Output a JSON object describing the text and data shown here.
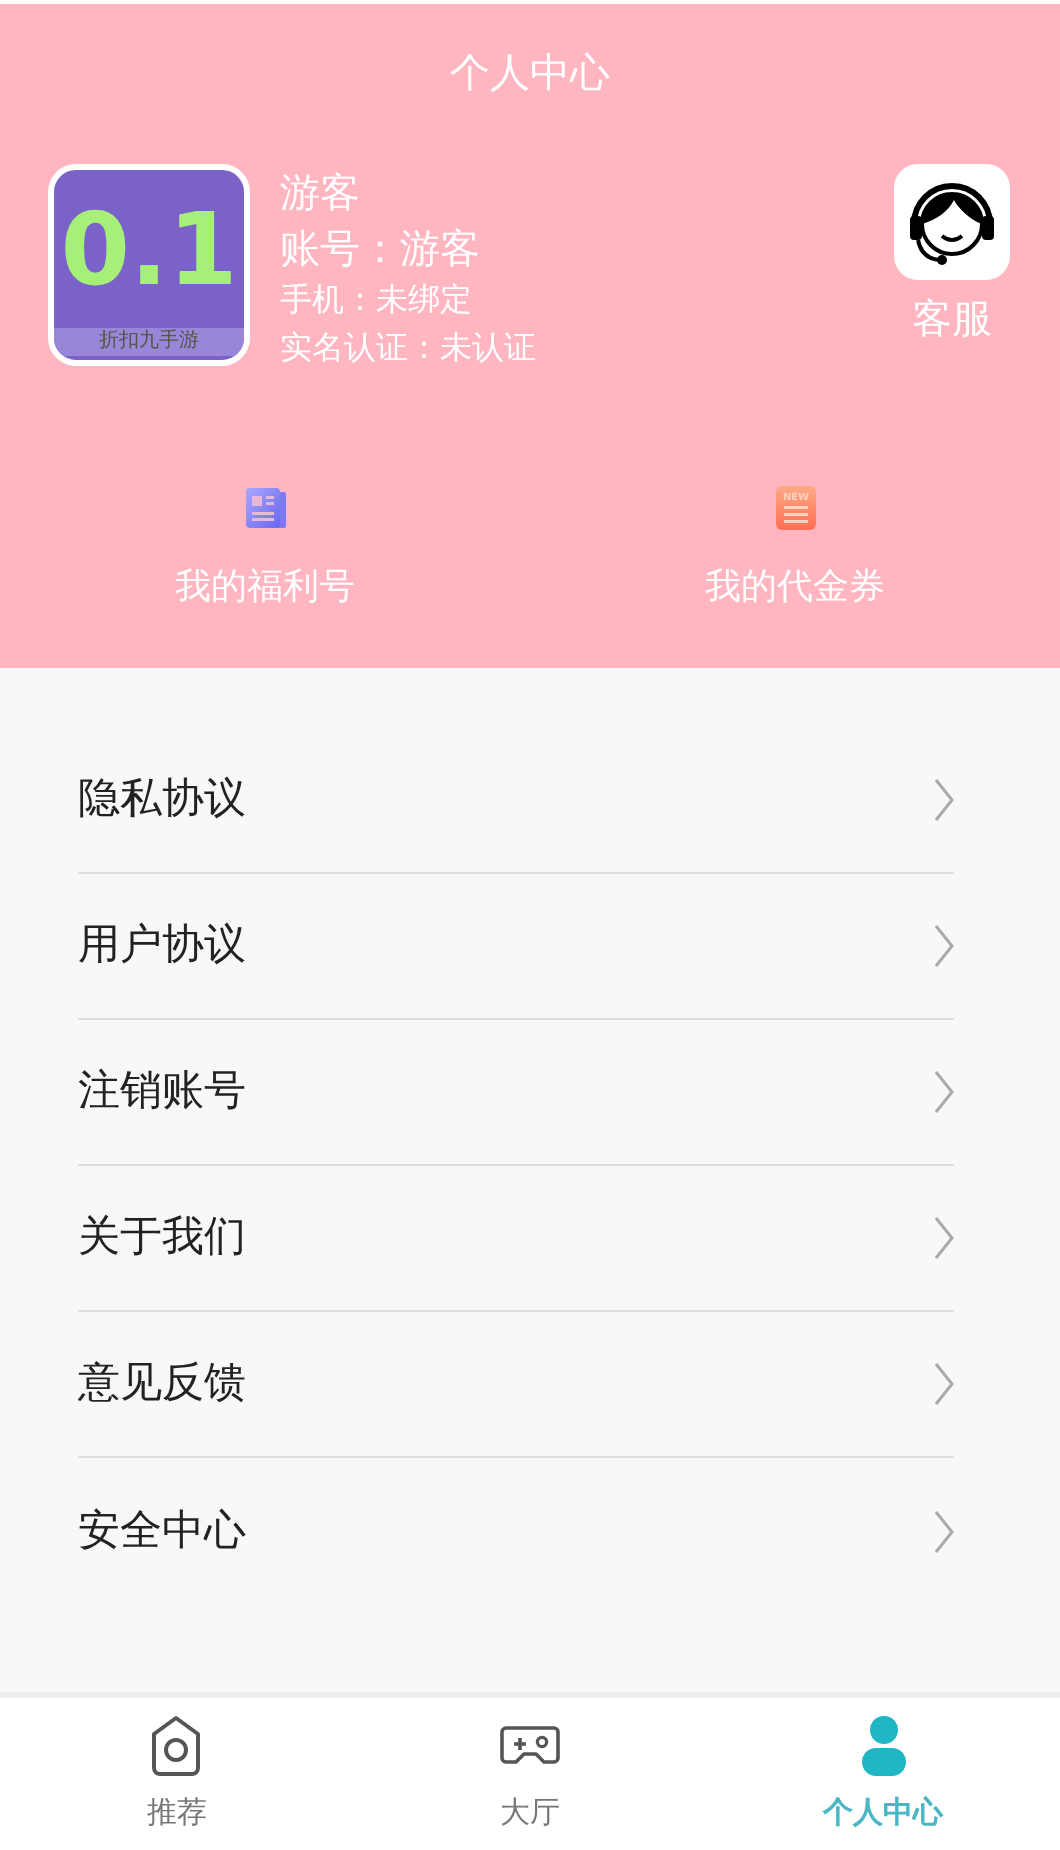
{
  "header": {
    "title": "个人中心"
  },
  "profile": {
    "logo": {
      "big": "0.1",
      "caption": "折扣九手游"
    },
    "name": "游客",
    "account": "账号：游客",
    "phone": "手机：未绑定",
    "verify": "实名认证：未认证"
  },
  "support": {
    "label": "客服"
  },
  "shortcuts": [
    {
      "kind": "welfare",
      "label": "我的福利号"
    },
    {
      "kind": "voucher",
      "label": "我的代金券",
      "icon_text": "NEW"
    }
  ],
  "menu": [
    {
      "label": "隐私协议"
    },
    {
      "label": "用户协议"
    },
    {
      "label": "注销账号"
    },
    {
      "label": "关于我们"
    },
    {
      "label": "意见反馈"
    },
    {
      "label": "安全中心"
    }
  ],
  "tabs": [
    {
      "kind": "home",
      "label": "推荐",
      "selected": false
    },
    {
      "kind": "game",
      "label": "大厅",
      "selected": false
    },
    {
      "kind": "user",
      "label": "个人中心",
      "selected": true
    }
  ]
}
